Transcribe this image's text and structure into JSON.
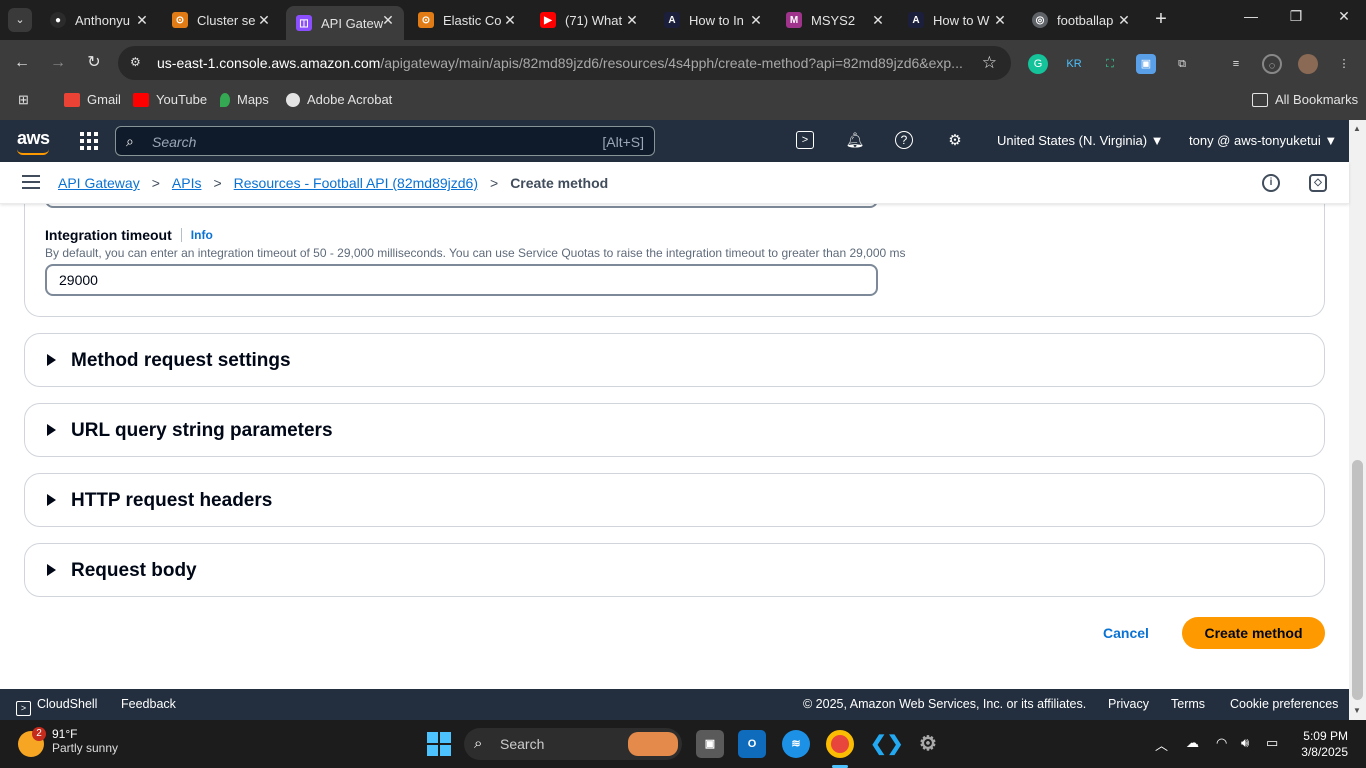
{
  "browser": {
    "tabs": [
      {
        "title": "Anthonyu",
        "color": "#2b2b2b",
        "glyph": "GH"
      },
      {
        "title": "Cluster se",
        "color": "#e07b16",
        "glyph": "⊙"
      },
      {
        "title": "API Gatew",
        "color": "#8c4fff",
        "glyph": "◫"
      },
      {
        "title": "Elastic Co",
        "color": "#e07b16",
        "glyph": "⊙"
      },
      {
        "title": "(71) What",
        "color": "#ff0000",
        "glyph": "▶"
      },
      {
        "title": "How to In",
        "color": "#1b1f3b",
        "glyph": "A"
      },
      {
        "title": "MSYS2",
        "color": "#a0348c",
        "glyph": "M"
      },
      {
        "title": "How to W",
        "color": "#1b1f3b",
        "glyph": "A"
      },
      {
        "title": "footballap",
        "color": "#5f6368",
        "glyph": "◎"
      }
    ],
    "url_domain": "us-east-1.console.aws.amazon.com",
    "url_path": "/apigateway/main/apis/82md89jzd6/resources/4s4pph/create-method?api=82md89jzd6&exp...",
    "bookmarks": [
      "Gmail",
      "YouTube",
      "Maps",
      "Adobe Acrobat"
    ],
    "all_bookmarks": "All Bookmarks"
  },
  "aws_header": {
    "logo": "aws",
    "search_placeholder": "Search",
    "search_shortcut": "[Alt+S]",
    "region": "United States (N. Virginia) ▼",
    "account": "tony @ aws-tonyuketui ▼"
  },
  "breadcrumbs": {
    "items": [
      "API Gateway",
      "APIs",
      "Resources - Football API (82md89jzd6)"
    ],
    "current": "Create method"
  },
  "integration_timeout": {
    "label": "Integration timeout",
    "info": "Info",
    "description": "By default, you can enter an integration timeout of 50 - 29,000 milliseconds. You can use Service Quotas to raise the integration timeout to greater than 29,000 ms",
    "value": "29000"
  },
  "sections": [
    "Method request settings",
    "URL query string parameters",
    "HTTP request headers",
    "Request body"
  ],
  "actions": {
    "cancel": "Cancel",
    "create": "Create method"
  },
  "footer": {
    "cloudshell": "CloudShell",
    "feedback": "Feedback",
    "copyright": "© 2025, Amazon Web Services, Inc. or its affiliates.",
    "privacy": "Privacy",
    "terms": "Terms",
    "cookies": "Cookie preferences"
  },
  "taskbar": {
    "weather_temp": "91°F",
    "weather_desc": "Partly sunny",
    "weather_badge": "2",
    "search_placeholder": "Search",
    "time": "5:09 PM",
    "date": "3/8/2025"
  },
  "colors": {
    "aws_navy": "#232f3e",
    "aws_orange": "#ff9900",
    "link_blue": "#0972d3"
  }
}
